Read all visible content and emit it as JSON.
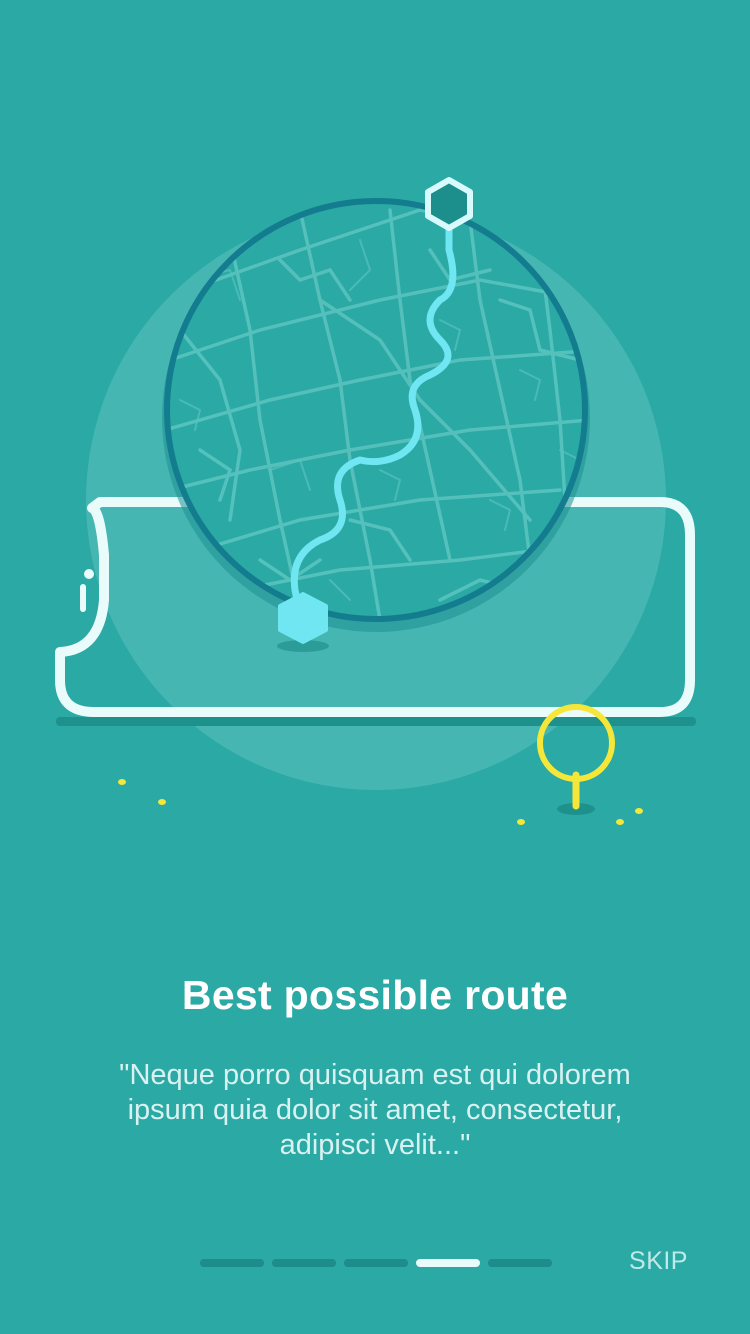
{
  "onboarding": {
    "title": "Best possible route",
    "description": "\"Neque porro quisquam est qui dolorem ipsum quia dolor sit amet, consectetur, adipisci velit...\"",
    "skip_label": "SKIP",
    "pager": {
      "total": 5,
      "active_index": 3
    }
  },
  "colors": {
    "background": "#2aa9a5",
    "route": "#6fe6f2",
    "pin": "#f5e73a",
    "phone_outline": "#e9fbfa",
    "map_ring": "#137c8e"
  },
  "icons": [
    "map-illustration",
    "route-start-hexagon-icon",
    "route-end-hexagon-icon",
    "location-pin-icon",
    "phone-outline"
  ]
}
